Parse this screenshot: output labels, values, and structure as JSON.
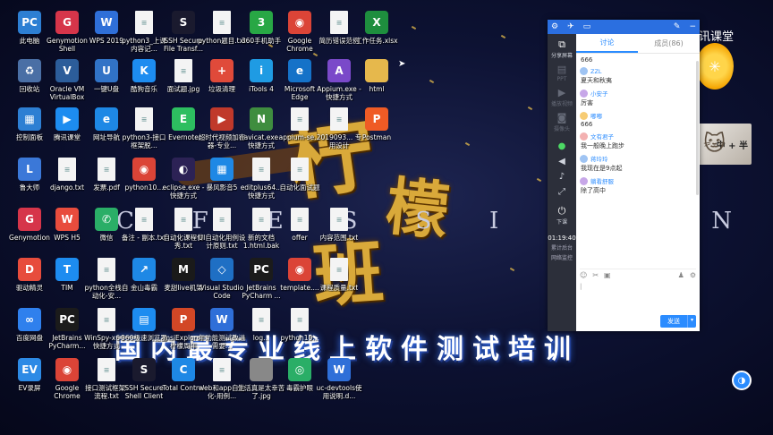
{
  "desktop_icons": [
    {
      "label": "此电脑",
      "glyph": "PC",
      "color": "#2d7fd3"
    },
    {
      "label": "Genymotion Shell",
      "glyph": "G",
      "color": "#d6354a"
    },
    {
      "label": "WPS 2019",
      "glyph": "W",
      "color": "#2f6fd8"
    },
    {
      "label": "python3_上课内容记...",
      "glyph": "",
      "color": "doc"
    },
    {
      "label": "SSH Secure File Transf...",
      "glyph": "S",
      "color": "#1a1a2e"
    },
    {
      "label": "python题目.txt",
      "glyph": "",
      "color": "doc"
    },
    {
      "label": "360手机助手",
      "glyph": "3",
      "color": "#28a745"
    },
    {
      "label": "Google Chrome",
      "glyph": "◉",
      "color": "#db4437"
    },
    {
      "label": "简历错误范例",
      "glyph": "",
      "color": "doc"
    },
    {
      "label": "工作任务.xlsx",
      "glyph": "X",
      "color": "#1e8e3e"
    },
    {
      "label": "回收站",
      "glyph": "♻",
      "color": "#4a6fa5"
    },
    {
      "label": "Oracle VM VirtualBox",
      "glyph": "V",
      "color": "#2c5d9a"
    },
    {
      "label": "一键U盘",
      "glyph": "U",
      "color": "#3173c6"
    },
    {
      "label": "酷狗音乐",
      "glyph": "K",
      "color": "#1d8cf0"
    },
    {
      "label": "面试题.jpg",
      "glyph": "",
      "color": "doc"
    },
    {
      "label": "垃圾清理",
      "glyph": "+",
      "color": "#e04a3a"
    },
    {
      "label": "iTools 4",
      "glyph": "i",
      "color": "#1f9be3"
    },
    {
      "label": "Microsoft Edge",
      "glyph": "e",
      "color": "#1572c8"
    },
    {
      "label": "Appium.exe - 快捷方式",
      "glyph": "A",
      "color": "#7a49c9"
    },
    {
      "label": "html",
      "glyph": "",
      "color": "#e6b84c"
    },
    {
      "label": "控制面板",
      "glyph": "▦",
      "color": "#2d7fd3"
    },
    {
      "label": "腾讯课堂",
      "glyph": "▶",
      "color": "#1d8cf0"
    },
    {
      "label": "网址导航",
      "glyph": "e",
      "color": "#1e88e5"
    },
    {
      "label": "python3-接口框架脱...",
      "glyph": "",
      "color": "doc"
    },
    {
      "label": "Evernote",
      "glyph": "E",
      "color": "#2dbe60"
    },
    {
      "label": "超时代视频加密器-专业...",
      "glyph": "▶",
      "color": "#c0392b"
    },
    {
      "label": "navicat.exe - 快捷方式",
      "glyph": "N",
      "color": "#3f8d3f"
    },
    {
      "label": "appium-se...",
      "glyph": "",
      "color": "doc"
    },
    {
      "label": "2019093... 专用设计",
      "glyph": "",
      "color": "doc"
    },
    {
      "label": "Postman",
      "glyph": "P",
      "color": "#ef5b25"
    },
    {
      "label": "鲁大师",
      "glyph": "L",
      "color": "#3b78d8"
    },
    {
      "label": "django.txt",
      "glyph": "",
      "color": "doc"
    },
    {
      "label": "发票.pdf",
      "glyph": "",
      "color": "doc"
    },
    {
      "label": "python10...",
      "glyph": "◉",
      "color": "#db4437"
    },
    {
      "label": "eclipse.exe - 快捷方式",
      "glyph": "◐",
      "color": "#2c2255"
    },
    {
      "label": "暴风影音5",
      "glyph": "▦",
      "color": "#1e88e5"
    },
    {
      "label": "editplus64... 快捷方式",
      "glyph": "",
      "color": "doc"
    },
    {
      "label": "自动化面试题",
      "glyph": "",
      "color": "doc"
    },
    {
      "label": "Genymotion",
      "glyph": "G",
      "color": "#d6354a"
    },
    {
      "label": "WPS H5",
      "glyph": "W",
      "color": "#e84c3d"
    },
    {
      "label": "微信",
      "glyph": "✆",
      "color": "#2aae67"
    },
    {
      "label": "备注 - 副本.txt",
      "glyph": "",
      "color": "doc"
    },
    {
      "label": "自动化课程优秀.txt",
      "glyph": "",
      "color": "doc"
    },
    {
      "label": "UI自动化用例设计原则.txt",
      "glyph": "",
      "color": "doc"
    },
    {
      "label": "新的文档1.html.bak",
      "glyph": "",
      "color": "doc"
    },
    {
      "label": "offer",
      "glyph": "",
      "color": "doc"
    },
    {
      "label": "内容范围.txt",
      "glyph": "",
      "color": "doc"
    },
    {
      "label": "驱动精灵",
      "glyph": "D",
      "color": "#e74c3c"
    },
    {
      "label": "TIM",
      "glyph": "T",
      "color": "#1d8cf0"
    },
    {
      "label": "python全栈自动化-安...",
      "glyph": "",
      "color": "doc"
    },
    {
      "label": "金山毒霸",
      "glyph": "↗",
      "color": "#1e88e5"
    },
    {
      "label": "麦甜live机架",
      "glyph": "M",
      "color": "#1a1a1a"
    },
    {
      "label": "Visual Studio Code",
      "glyph": "◇",
      "color": "#1f6fc4"
    },
    {
      "label": "JetBrains PyCharm ...",
      "glyph": "PC",
      "color": "#1b1b1b"
    },
    {
      "label": "template....",
      "glyph": "◉",
      "color": "#db4437"
    },
    {
      "label": "课程质量.txt",
      "glyph": "",
      "color": "doc"
    },
    {
      "label": "百度网盘",
      "glyph": "∞",
      "color": "#2f80ed"
    },
    {
      "label": "JetBrains PyCharm...",
      "glyph": "PC",
      "color": "#1b1b1b"
    },
    {
      "label": "WinSpy-x64 - 快捷方式",
      "glyph": "",
      "color": "doc"
    },
    {
      "label": "360极速浏览器",
      "glyph": "▤",
      "color": "#1d8cf0"
    },
    {
      "label": "msiExplorer 柠檬周年庆.pptx",
      "glyph": "P",
      "color": "#d24726"
    },
    {
      "label": "年功能测试改进需要...",
      "glyph": "W",
      "color": "#2f6fd8"
    },
    {
      "label": "log...",
      "glyph": "",
      "color": "doc"
    },
    {
      "label": "python10...",
      "glyph": "",
      "color": "doc"
    },
    {
      "label": "EV录屏",
      "glyph": "EV",
      "color": "#2d8ae5"
    },
    {
      "label": "Google Chrome",
      "glyph": "◉",
      "color": "#db4437"
    },
    {
      "label": "接口测试框架-流程.txt",
      "glyph": "",
      "color": "doc"
    },
    {
      "label": "SSH Secure Shell Client",
      "glyph": "S",
      "color": "#1a1a2e"
    },
    {
      "label": "Total Control",
      "glyph": "C",
      "color": "#1e88e5"
    },
    {
      "label": "web和app自动化-用例...",
      "glyph": "",
      "color": "doc"
    },
    {
      "label": "生活真是太幸苦了.jpg",
      "glyph": "",
      "color": "#888"
    },
    {
      "label": "毒霸护眼",
      "glyph": "◎",
      "color": "#2aae67"
    },
    {
      "label": "uc-devtools使用说明.d...",
      "glyph": "W",
      "color": "#2f6fd8"
    }
  ],
  "wallpaper": {
    "char1": "柠",
    "char2": "檬",
    "char3": "班",
    "letters": [
      "C",
      "F",
      "E",
      "S",
      "S",
      "I",
      "O",
      "U",
      "N"
    ],
    "slogan": "国内最专业线上软件测试培训"
  },
  "tencent": {
    "brand": "腾讯课堂"
  },
  "kitten": {
    "text": "中 + 半"
  },
  "panel": {
    "side": {
      "share_screen": "分享屏幕",
      "ppt": "PPT",
      "play_video": "播放视频",
      "camera": "摄像头",
      "mic_label": "",
      "exit": "下课",
      "time": "01:19:40",
      "stat1": "累计后台",
      "stat2": "网络监控"
    },
    "tabs": {
      "discuss": "讨论",
      "members": "成员(86)"
    },
    "messages": [
      {
        "name": "",
        "text": "666",
        "avatar": ""
      },
      {
        "name": "ZZL",
        "text": "夏天和秋夷",
        "avatar": "b"
      },
      {
        "name": "小安子",
        "text": "厉害",
        "avatar": "c"
      },
      {
        "name": "嘟嘟",
        "text": "666",
        "avatar": "d"
      },
      {
        "name": "文有君子",
        "text": "我一般晚上跑步",
        "avatar": ""
      },
      {
        "name": "蒋玲玲",
        "text": "我现在是9点起",
        "avatar": "b"
      },
      {
        "name": "躺看舒服",
        "text": "除了高中",
        "avatar": "c"
      }
    ],
    "send_label": "发送"
  }
}
